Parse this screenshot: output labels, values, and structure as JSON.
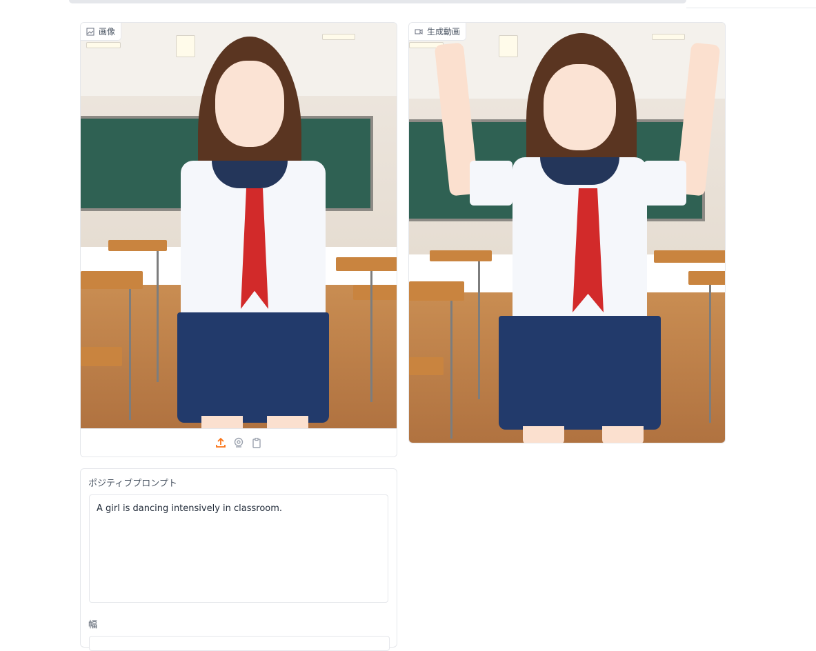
{
  "image_panel": {
    "label": "画像",
    "icon": "image-icon"
  },
  "video_panel": {
    "label": "生成動画",
    "icon": "video-icon"
  },
  "toolbar": {
    "fullscreen_icon": "fullscreen-icon",
    "close_icon": "close-icon"
  },
  "upload_tools": [
    "upload-icon",
    "webcam-icon",
    "clipboard-icon"
  ],
  "form": {
    "positive_prompt_label": "ポジティブプロンプト",
    "positive_prompt_value": "A girl is dancing intensively in classroom.",
    "width_label": "幅"
  },
  "colors": {
    "accent": "#f97316",
    "border": "#e5e7eb"
  }
}
